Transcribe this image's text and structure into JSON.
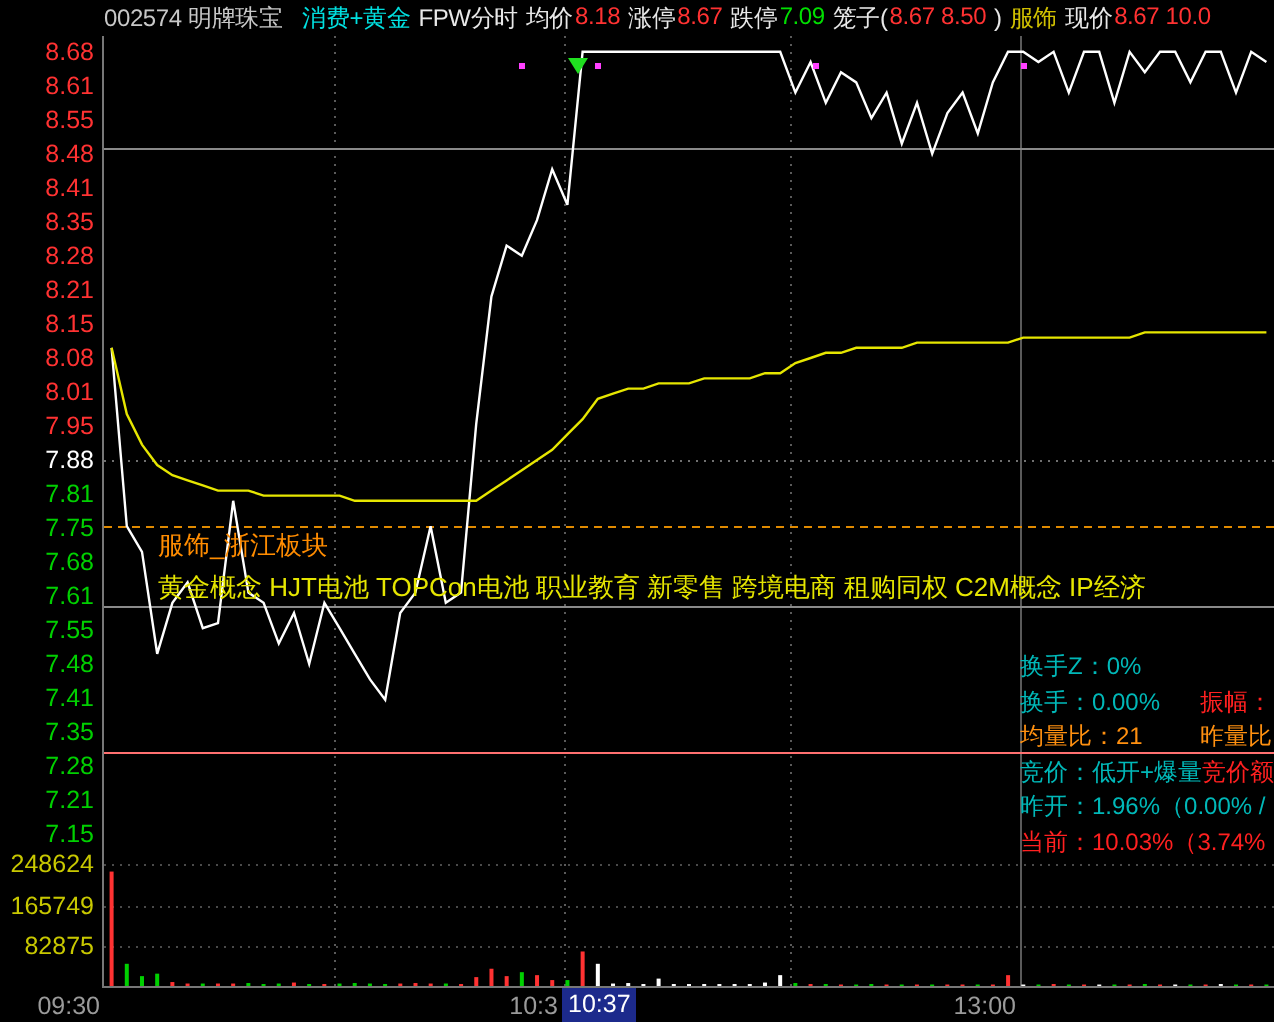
{
  "header": [
    {
      "text": "002574 明牌珠宝",
      "kind": "name"
    },
    {
      "text": "消费+黄金",
      "kind": "sector"
    },
    {
      "text": "FPW分时",
      "kind": "label"
    },
    {
      "text": "均价",
      "kind": "label"
    },
    {
      "text": "8.18",
      "kind": "up"
    },
    {
      "text": "涨停",
      "kind": "label"
    },
    {
      "text": "8.67",
      "kind": "up"
    },
    {
      "text": "跌停",
      "kind": "label"
    },
    {
      "text": "7.09",
      "kind": "down"
    },
    {
      "text": "笼子(",
      "kind": "label"
    },
    {
      "text": "8.67 8.50",
      "kind": "up"
    },
    {
      "text": ")",
      "kind": "label"
    },
    {
      "text": "服饰",
      "kind": "tag"
    },
    {
      "text": "现价",
      "kind": "label"
    },
    {
      "text": "8.67 10.0",
      "kind": "up"
    }
  ],
  "time_axis": [
    {
      "text": "09:30",
      "kind": "tick"
    },
    {
      "text": "10:3",
      "kind": "tick"
    },
    {
      "text": "10:37",
      "kind": "cursor"
    },
    {
      "text": "13:00",
      "kind": "tick"
    }
  ],
  "price_chart": {
    "chart_data": {
      "type": "line",
      "grid": true,
      "ylim": [
        7.135,
        8.711
      ],
      "ref_lines": [
        {
          "axis": "y",
          "value": 7.88
        },
        {
          "axis": "y",
          "value": 8.493
        },
        {
          "axis": "y",
          "value": 7.595
        },
        {
          "axis": "y",
          "value": 7.749
        },
        {
          "axis": "y",
          "value": 7.306
        }
      ],
      "yticks": [
        {
          "value": 8.68,
          "label": "8.68"
        },
        {
          "value": 8.613,
          "label": "8.61"
        },
        {
          "value": 8.547,
          "label": "8.55"
        },
        {
          "value": 8.48,
          "label": "8.48"
        },
        {
          "value": 8.413,
          "label": "8.41"
        },
        {
          "value": 8.347,
          "label": "8.35"
        },
        {
          "value": 8.28,
          "label": "8.28"
        },
        {
          "value": 8.213,
          "label": "8.21"
        },
        {
          "value": 8.147,
          "label": "8.15"
        },
        {
          "value": 8.08,
          "label": "8.08"
        },
        {
          "value": 8.013,
          "label": "8.01"
        },
        {
          "value": 7.947,
          "label": "7.95"
        },
        {
          "value": 7.88,
          "label": "7.88"
        },
        {
          "value": 7.813,
          "label": "7.81"
        },
        {
          "value": 7.747,
          "label": "7.75"
        },
        {
          "value": 7.68,
          "label": "7.68"
        },
        {
          "value": 7.613,
          "label": "7.61"
        },
        {
          "value": 7.547,
          "label": "7.55"
        },
        {
          "value": 7.48,
          "label": "7.48"
        },
        {
          "value": 7.413,
          "label": "7.41"
        },
        {
          "value": 7.347,
          "label": "7.35"
        },
        {
          "value": 7.28,
          "label": "7.28"
        },
        {
          "value": 7.213,
          "label": "7.21"
        },
        {
          "value": 7.147,
          "label": "7.15"
        }
      ],
      "categories": [
        null,
        null,
        null,
        null,
        null,
        null,
        null,
        null,
        null,
        null,
        null,
        null,
        null,
        null,
        null,
        null,
        null,
        null,
        null,
        null,
        null,
        null,
        null,
        null,
        null,
        null,
        null,
        null,
        null,
        null,
        null,
        null,
        null,
        null,
        null,
        null,
        null,
        null,
        null,
        null,
        null,
        null,
        null,
        null,
        null,
        null,
        null,
        null,
        null,
        null,
        null,
        null,
        null,
        null,
        null,
        null,
        null,
        null,
        null,
        null,
        null,
        null,
        null,
        null,
        null,
        null,
        null,
        null,
        null,
        null,
        null,
        null,
        null,
        null,
        null,
        null,
        null
      ],
      "series": [
        {
          "color": "#ffffff",
          "values": [
            8.1,
            7.75,
            7.7,
            7.5,
            7.6,
            7.64,
            7.55,
            7.56,
            7.8,
            7.62,
            7.6,
            7.52,
            7.58,
            7.48,
            7.6,
            7.55,
            7.5,
            7.45,
            7.41,
            7.58,
            7.62,
            7.75,
            7.6,
            7.62,
            7.95,
            8.2,
            8.3,
            8.28,
            8.35,
            8.45,
            8.38,
            8.68,
            8.68,
            8.68,
            8.68,
            8.68,
            8.68,
            8.68,
            8.68,
            8.68,
            8.68,
            8.68,
            8.68,
            8.68,
            8.68,
            8.6,
            8.66,
            8.58,
            8.64,
            8.62,
            8.55,
            8.6,
            8.5,
            8.58,
            8.48,
            8.56,
            8.6,
            8.52,
            8.62,
            8.68,
            8.68,
            8.66,
            8.68,
            8.6,
            8.68,
            8.68,
            8.58,
            8.68,
            8.64,
            8.68,
            8.68,
            8.62,
            8.68,
            8.68,
            8.6,
            8.68,
            8.66
          ]
        },
        {
          "color": "#e6e600",
          "values": [
            8.1,
            7.97,
            7.91,
            7.87,
            7.85,
            7.84,
            7.83,
            7.82,
            7.82,
            7.82,
            7.81,
            7.81,
            7.81,
            7.81,
            7.81,
            7.81,
            7.8,
            7.8,
            7.8,
            7.8,
            7.8,
            7.8,
            7.8,
            7.8,
            7.8,
            7.82,
            7.84,
            7.86,
            7.88,
            7.9,
            7.93,
            7.96,
            8.0,
            8.01,
            8.02,
            8.02,
            8.03,
            8.03,
            8.03,
            8.04,
            8.04,
            8.04,
            8.04,
            8.05,
            8.05,
            8.07,
            8.08,
            8.09,
            8.09,
            8.1,
            8.1,
            8.1,
            8.1,
            8.11,
            8.11,
            8.11,
            8.11,
            8.11,
            8.11,
            8.11,
            8.12,
            8.12,
            8.12,
            8.12,
            8.12,
            8.12,
            8.12,
            8.12,
            8.13,
            8.13,
            8.13,
            8.13,
            8.13,
            8.13,
            8.13,
            8.13,
            8.13
          ]
        }
      ]
    }
  },
  "tags": [
    {
      "text": "服饰_浙江板块",
      "kind": "sector"
    },
    {
      "text": "黄金概念 HJT电池 TOPCon电池 职业教育 新零售 跨境电商 租购同权 C2M概念 IP经济",
      "kind": "concept"
    }
  ],
  "info_panel": [
    {
      "main": {
        "text": "换手Z：0%",
        "kind": "teal"
      }
    },
    {
      "main": {
        "text": "换手：0.00%",
        "kind": "teal"
      },
      "aside": {
        "text": "振幅：",
        "kind": "red"
      }
    },
    {
      "main": {
        "text": "均量比：21",
        "kind": "orange"
      },
      "aside": {
        "text": "昨量比",
        "kind": "orange"
      }
    },
    {
      "main": {
        "text": "竞价：低开+爆量",
        "kind": "teal"
      },
      "tail": {
        "text": "竞价额",
        "kind": "red"
      }
    },
    {
      "main": {
        "text": "昨开：1.96%（0.00% /",
        "kind": "teal"
      }
    },
    {
      "main": {
        "text": "当前：10.03%（3.74%",
        "kind": "red"
      }
    }
  ],
  "volume_chart": {
    "chart_data": {
      "type": "bar",
      "grid": true,
      "ylim": [
        0,
        296000
      ],
      "yticks": [
        {
          "value": 248624,
          "label": "248624"
        },
        {
          "value": 165749,
          "label": "165749"
        },
        {
          "value": 82875,
          "label": "82875"
        }
      ],
      "categories": [
        null,
        null,
        null,
        null,
        null,
        null,
        null,
        null,
        null,
        null,
        null,
        null,
        null,
        null,
        null,
        null,
        null,
        null,
        null,
        null,
        null,
        null,
        null,
        null,
        null,
        null,
        null,
        null,
        null,
        null,
        null,
        null,
        null,
        null,
        null,
        null,
        null,
        null,
        null,
        null,
        null,
        null,
        null,
        null,
        null,
        null,
        null,
        null,
        null,
        null,
        null,
        null,
        null,
        null,
        null,
        null,
        null,
        null,
        null,
        null,
        null,
        null,
        null,
        null,
        null,
        null,
        null,
        null,
        null,
        null,
        null,
        null,
        null,
        null,
        null,
        null,
        null
      ],
      "series": [
        {
          "values": [
            232000,
            45000,
            20000,
            25000,
            8000,
            5000,
            5000,
            5000,
            5000,
            6000,
            4000,
            5000,
            7000,
            4000,
            4000,
            5000,
            6000,
            5000,
            4000,
            5000,
            6000,
            5000,
            5000,
            4000,
            18000,
            35000,
            20000,
            28000,
            22000,
            12000,
            12000,
            70000,
            45000,
            5000,
            6000,
            4000,
            15000,
            4000,
            4000,
            4000,
            4000,
            4000,
            4000,
            7000,
            22000,
            6000,
            4000,
            4000,
            3000,
            3000,
            4000,
            3000,
            3000,
            3000,
            3000,
            3000,
            3000,
            3000,
            3000,
            22000,
            3000,
            3000,
            4000,
            3000,
            3000,
            3000,
            3000,
            3000,
            4000,
            3000,
            3000,
            3000,
            3000,
            4000,
            3000,
            3000,
            3000
          ]
        }
      ]
    }
  }
}
